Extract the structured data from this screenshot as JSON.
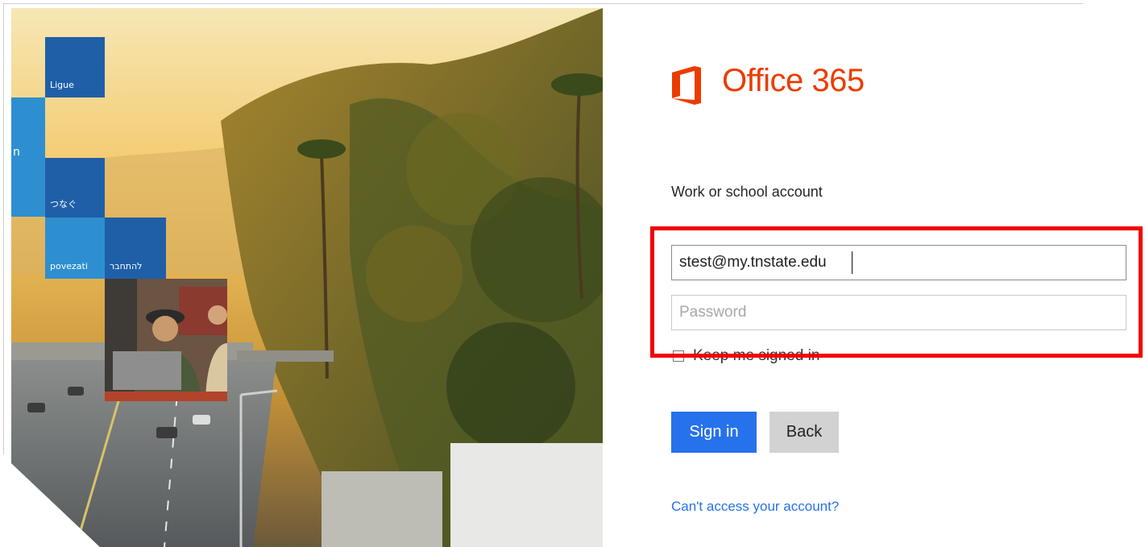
{
  "hero": {
    "tiles": [
      {
        "label": "Ligue"
      },
      {
        "label": "n"
      },
      {
        "label": "つなぐ"
      },
      {
        "label": "povezati"
      },
      {
        "label": "להתחבר"
      }
    ]
  },
  "brand": {
    "logo_icon": "office-logo-icon",
    "title": "Office 365",
    "color": "#eb3c00"
  },
  "signin": {
    "account_label": "Work or school account",
    "username_value": "stest@my.tnstate.edu",
    "password_placeholder": "Password",
    "keep_signed_in_label": "Keep me signed in",
    "keep_signed_in_checked": false,
    "signin_button": "Sign in",
    "back_button": "Back",
    "help_link": "Can't access your account?"
  },
  "colors": {
    "primary_button": "#2672ec",
    "secondary_button": "#d2d2d2",
    "highlight": "#f20000",
    "tile_dark": "#1f5fa8",
    "tile_light": "#2e8fd0"
  }
}
